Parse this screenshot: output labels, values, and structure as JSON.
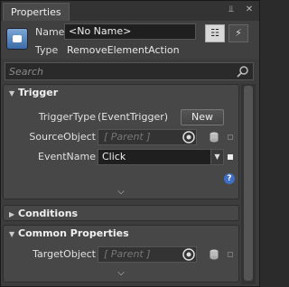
{
  "window": {
    "title": "Properties",
    "pin_icon": "pin-icon",
    "close_icon": "close-icon"
  },
  "header": {
    "name_label": "Name",
    "name_value": "<No Name>",
    "type_label": "Type",
    "type_value": "RemoveElementAction",
    "properties_view_icon": "properties-view-icon",
    "events_view_icon": "events-view-icon"
  },
  "search": {
    "placeholder": "Search"
  },
  "sections": {
    "trigger": {
      "title": "Trigger",
      "trigger_type_label": "TriggerType",
      "trigger_type_value": "(EventTrigger)",
      "new_button": "New",
      "source_object_label": "SourceObject",
      "source_object_placeholder": "[ Parent ]",
      "event_name_label": "EventName",
      "event_name_value": "Click"
    },
    "conditions": {
      "title": "Conditions"
    },
    "common": {
      "title": "Common Properties",
      "target_object_label": "TargetObject",
      "target_object_placeholder": "[ Parent ]"
    }
  },
  "colors": {
    "panel_bg": "#3c3c3c",
    "section_bg": "#474747",
    "help_blue": "#3f6fc4"
  }
}
